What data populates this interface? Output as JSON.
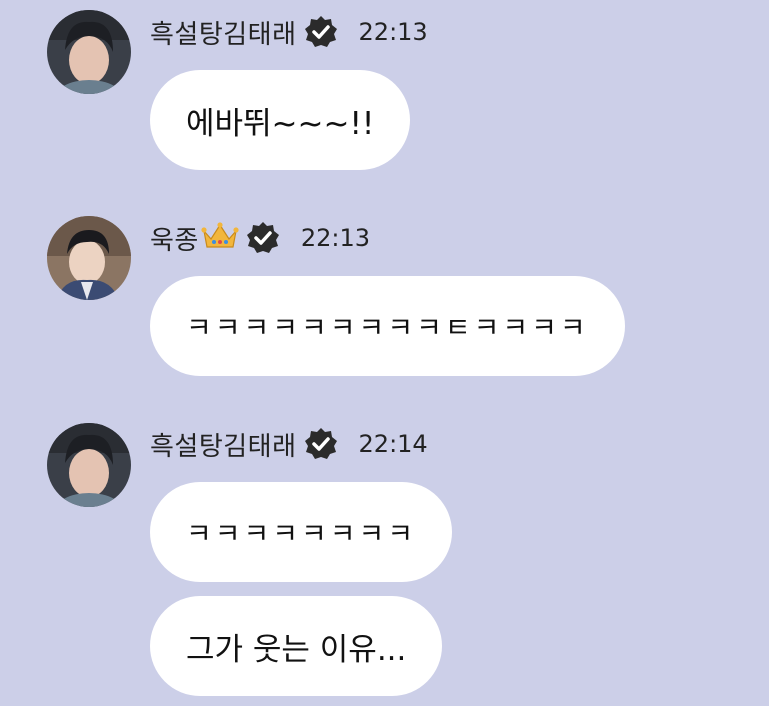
{
  "messages": [
    {
      "sender": "흑설탕김태래",
      "time": "22:13",
      "bubbles": [
        "에바뛰~~~!!"
      ],
      "badge": "verified-icon"
    },
    {
      "sender": "욱종",
      "time": "22:13",
      "sender_emoji": "crown-icon",
      "bubbles": [
        "ㅋㅋㅋㅋㅋㅋㅋㅋㅋㅌㅋㅋㅋㅋ"
      ],
      "badge": "verified-icon"
    },
    {
      "sender": "흑설탕김태래",
      "time": "22:14",
      "bubbles": [
        "ㅋㅋㅋㅋㅋㅋㅋㅋ",
        "그가 웃는 이유..."
      ],
      "badge": "verified-icon"
    }
  ],
  "colors": {
    "background": "#cccfe8",
    "bubble": "#ffffff",
    "text": "#222222"
  }
}
